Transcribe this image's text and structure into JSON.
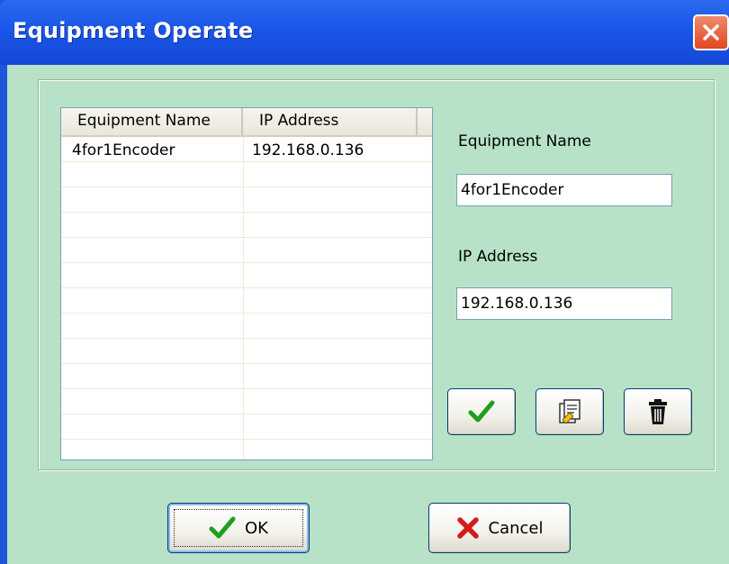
{
  "window": {
    "title": "Equipment Operate"
  },
  "list": {
    "columns": [
      "Equipment Name",
      "IP Address"
    ],
    "rows": [
      {
        "name": "4for1Encoder",
        "ip": "192.168.0.136"
      }
    ]
  },
  "form": {
    "name_label": "Equipment Name",
    "name_value": "4for1Encoder",
    "ip_label": "IP Address",
    "ip_value": "192.168.0.136"
  },
  "actions": {
    "confirm_icon": "checkmark-icon",
    "edit_icon": "edit-document-icon",
    "delete_icon": "trash-icon"
  },
  "buttons": {
    "ok_label": "OK",
    "cancel_label": "Cancel"
  },
  "colors": {
    "titlebar": "#1a56e8",
    "client_bg": "#b7e2c7",
    "close_button": "#e2461f",
    "check_green": "#1e9e1e",
    "cancel_red": "#d41c1c"
  }
}
